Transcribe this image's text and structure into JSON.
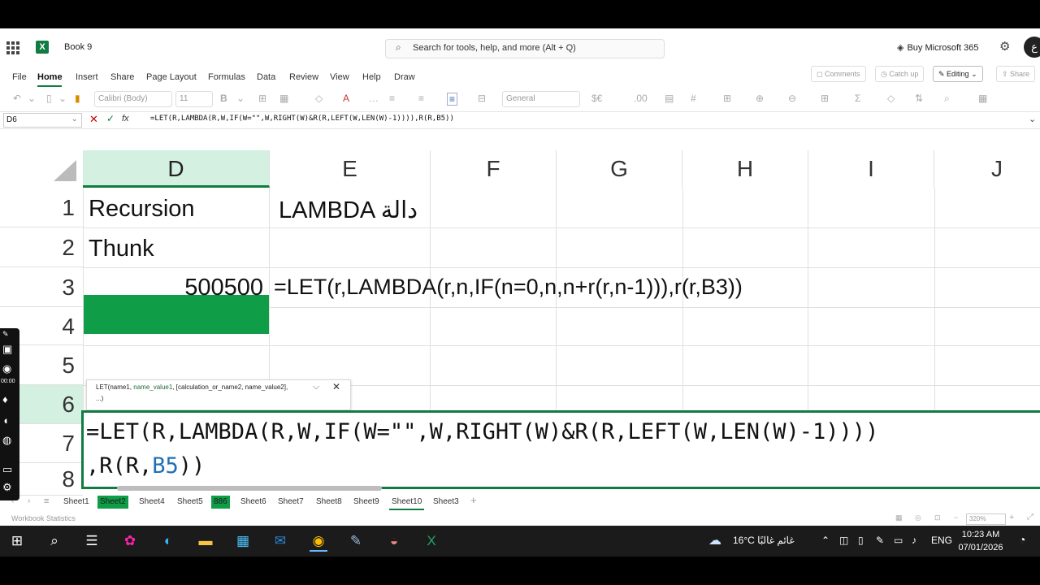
{
  "app": {
    "book_name": "Book 9",
    "search_placeholder": "Search for tools, help, and more (Alt + Q)",
    "buy_label": "Buy Microsoft 365",
    "avatar_letter": "ع",
    "brand_color": "#107c41",
    "fill_color": "#0f9d48"
  },
  "menu": [
    "File",
    "Home",
    "Insert",
    "Share",
    "Page Layout",
    "Formulas",
    "Data",
    "Review",
    "View",
    "Help",
    "Draw"
  ],
  "ribbon_right": {
    "comments": "Comments",
    "catchup": "Catch up",
    "editing": "Editing",
    "share": "Share"
  },
  "toolbar": {
    "font": "Calibri (Body)",
    "size": "11",
    "format": "General"
  },
  "formula_bar": {
    "name_box": "D6",
    "cancel": "✕",
    "enter": "✓",
    "fx": "fx",
    "content": "=LET(R,LAMBDA(R,W,IF(W=\"\",W,RIGHT(W)&R(R,LEFT(W,LEN(W)-1)))),R(R,B5))"
  },
  "columns": [
    "D",
    "E",
    "F",
    "G",
    "H",
    "I",
    "J"
  ],
  "rows": [
    "1",
    "2",
    "3",
    "4",
    "5",
    "6",
    "7",
    "8"
  ],
  "cells": {
    "D1": "Recursion",
    "E1": "LAMBDA دالة",
    "D2": "Thunk",
    "D3": "500500",
    "E3": "=LET(r,LAMBDA(r,n,IF(n=0,n,n+r(r,n-1))),r(r,B3))"
  },
  "tooltip": {
    "fn": "LET(",
    "arg1": "name1, ",
    "arg2": "name_value1",
    "rest": ", [calculation_or_name2, name_value2],",
    "line2": "...)"
  },
  "edit": {
    "line1": "=LET(R,LAMBDA(R,W,IF(W=\"\",W,RIGHT(W)&R(R,LEFT(W,LEN(W)-1))))",
    "line2_pre": ",R(R,",
    "line2_ref": "B5",
    "line2_post": "))"
  },
  "sheets": [
    "Sheet1",
    "Sheet2",
    "Sheet4",
    "Sheet5",
    "886",
    "Sheet6",
    "Sheet7",
    "Sheet8",
    "Sheet9",
    "Sheet10",
    "Sheet3"
  ],
  "status": {
    "text": "Workbook Statistics",
    "zoom": "320%"
  },
  "floatbar": {
    "time": "00:00"
  },
  "taskbar": {
    "weather": "16°C  غائم غالبًا",
    "lang": "ENG",
    "time": "10:23 AM",
    "date": "07/01/2026"
  }
}
